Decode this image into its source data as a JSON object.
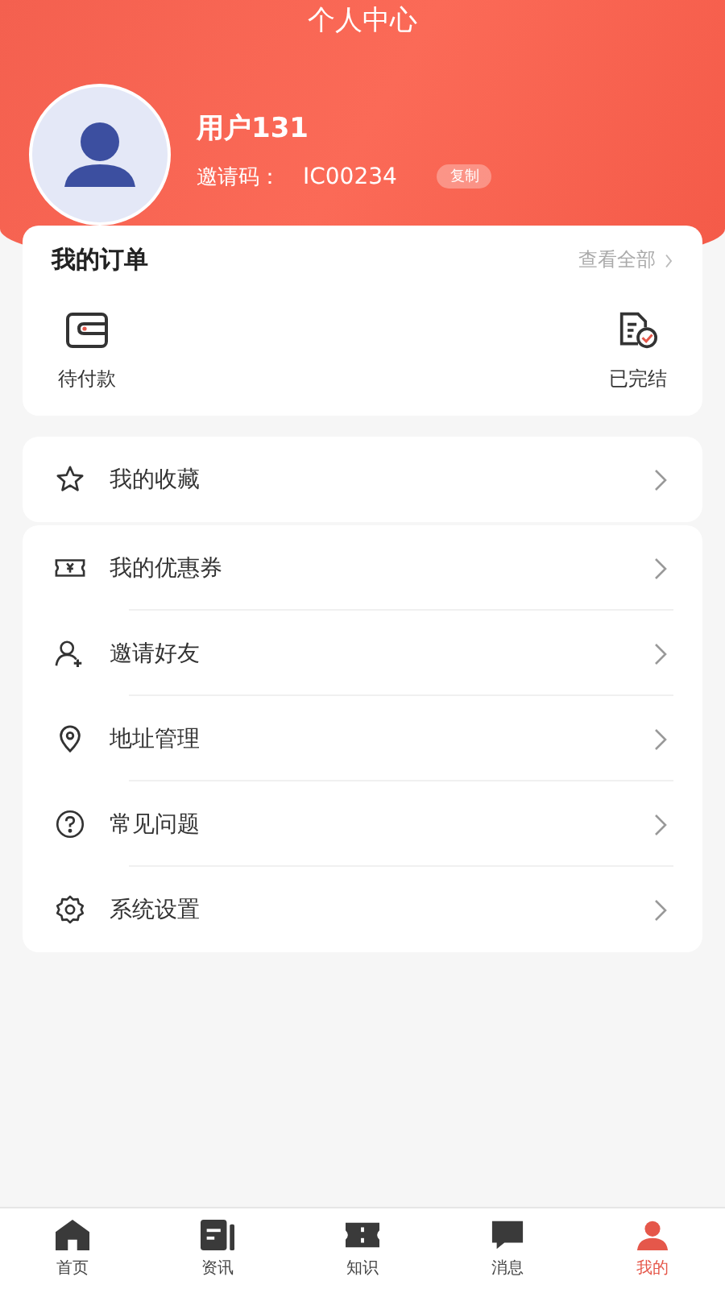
{
  "header": {
    "title": "个人中心"
  },
  "profile": {
    "name": "用户131",
    "invite_label": "邀请码：",
    "invite_code": "IC00234",
    "copy_button": "复制"
  },
  "orders": {
    "title": "我的订单",
    "view_all": "查看全部",
    "items": [
      {
        "kind": "wallet",
        "label": "待付款"
      },
      {
        "kind": "done",
        "label": "已完结"
      }
    ]
  },
  "favorites": {
    "kind": "star",
    "label": "我的收藏"
  },
  "menu": [
    {
      "kind": "coupon",
      "label": "我的优惠券"
    },
    {
      "kind": "invite",
      "label": "邀请好友"
    },
    {
      "kind": "location",
      "label": "地址管理"
    },
    {
      "kind": "help",
      "label": "常见问题"
    },
    {
      "kind": "settings",
      "label": "系统设置"
    }
  ],
  "tabs": [
    {
      "kind": "home",
      "label": "首页",
      "selected": false
    },
    {
      "kind": "news",
      "label": "资讯",
      "selected": false
    },
    {
      "kind": "knowledge",
      "label": "知识",
      "selected": false
    },
    {
      "kind": "message",
      "label": "消息",
      "selected": false
    },
    {
      "kind": "mine",
      "label": "我的",
      "selected": true
    }
  ]
}
